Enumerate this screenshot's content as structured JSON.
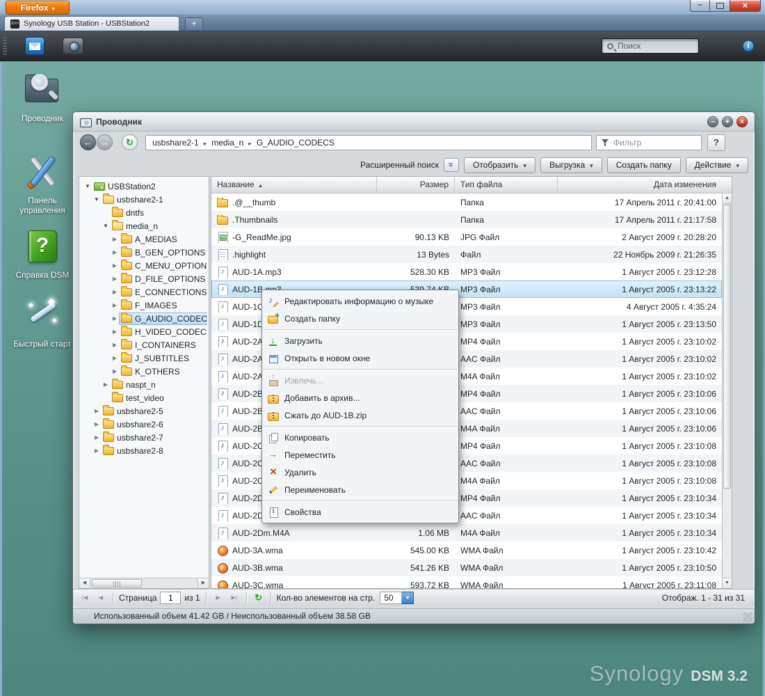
{
  "browser": {
    "firefox_label": "Firefox",
    "tab_title": "Synology USB Station - USBStation2",
    "new_tab_label": "+",
    "search_placeholder": "Поиск"
  },
  "desktop": {
    "icons": [
      {
        "label": "Проводник",
        "icon": "explorer-icon"
      },
      {
        "label": "Панель управления",
        "icon": "control-panel-icon"
      },
      {
        "label": "Справка DSM",
        "icon": "help-book-icon"
      },
      {
        "label": "Быстрый старт",
        "icon": "magic-wand-icon"
      }
    ],
    "watermark_brand": "Synology",
    "watermark_version": "DSM 3.2"
  },
  "explorer": {
    "title": "Проводник",
    "help_label": "?",
    "filter_placeholder": "Фильтр",
    "breadcrumb": [
      "usbshare2-1",
      "media_n",
      "G_AUDIO_CODECS"
    ],
    "toolbar": [
      {
        "label": "Отобразить",
        "dropdown": true
      },
      {
        "label": "Выгрузка",
        "dropdown": true
      },
      {
        "label": "Создать папку",
        "dropdown": false
      },
      {
        "label": "Действие",
        "dropdown": true
      }
    ],
    "advanced_search": "Расширенный поиск",
    "tree": [
      {
        "label": "USBStation2",
        "level": 0,
        "icon": "server",
        "arrow": "expanded"
      },
      {
        "label": "usbshare2-1",
        "level": 1,
        "icon": "folder-open",
        "arrow": "expanded"
      },
      {
        "label": "dntfs",
        "level": 2,
        "icon": "folder",
        "arrow": "none"
      },
      {
        "label": "media_n",
        "level": 2,
        "icon": "folder-open",
        "arrow": "expanded"
      },
      {
        "label": "A_MEDIAS",
        "level": 3,
        "icon": "folder",
        "arrow": "collapsed"
      },
      {
        "label": "B_GEN_OPTIONS",
        "level": 3,
        "icon": "folder",
        "arrow": "collapsed"
      },
      {
        "label": "C_MENU_OPTIONS",
        "level": 3,
        "icon": "folder",
        "arrow": "collapsed"
      },
      {
        "label": "D_FILE_OPTIONS",
        "level": 3,
        "icon": "folder",
        "arrow": "collapsed"
      },
      {
        "label": "E_CONNECTIONS",
        "level": 3,
        "icon": "folder",
        "arrow": "collapsed"
      },
      {
        "label": "F_IMAGES",
        "level": 3,
        "icon": "folder",
        "arrow": "collapsed"
      },
      {
        "label": "G_AUDIO_CODECS",
        "level": 3,
        "icon": "folder",
        "arrow": "collapsed",
        "selected": true
      },
      {
        "label": "H_VIDEO_CODECS",
        "level": 3,
        "icon": "folder",
        "arrow": "collapsed"
      },
      {
        "label": "I_CONTAINERS",
        "level": 3,
        "icon": "folder",
        "arrow": "collapsed"
      },
      {
        "label": "J_SUBTITLES",
        "level": 3,
        "icon": "folder",
        "arrow": "collapsed"
      },
      {
        "label": "K_OTHERS",
        "level": 3,
        "icon": "folder",
        "arrow": "collapsed"
      },
      {
        "label": "naspt_n",
        "level": 2,
        "icon": "folder",
        "arrow": "collapsed"
      },
      {
        "label": "test_video",
        "level": 2,
        "icon": "folder",
        "arrow": "none"
      },
      {
        "label": "usbshare2-5",
        "level": 1,
        "icon": "folder",
        "arrow": "collapsed"
      },
      {
        "label": "usbshare2-6",
        "level": 1,
        "icon": "folder",
        "arrow": "collapsed"
      },
      {
        "label": "usbshare2-7",
        "level": 1,
        "icon": "folder",
        "arrow": "collapsed"
      },
      {
        "label": "usbshare2-8",
        "level": 1,
        "icon": "folder",
        "arrow": "collapsed"
      }
    ],
    "columns": {
      "name": "Название",
      "size": "Размер",
      "type": "Тип файла",
      "date": "Дата изменения"
    },
    "files": [
      {
        "name": ".@__thumb",
        "size": "",
        "type": "Папка",
        "date": "17 Апрель 2011 г. 20:41:00",
        "icon": "folder"
      },
      {
        "name": ".Thumbnails",
        "size": "",
        "type": "Папка",
        "date": "17 Апрель 2011 г. 21:17:58",
        "icon": "folder"
      },
      {
        "name": "-G_ReadMe.jpg",
        "size": "90.13 KB",
        "type": "JPG Файл",
        "date": "2 Август 2009 г. 20:28:20",
        "icon": "image"
      },
      {
        "name": ".highlight",
        "size": "13 Bytes",
        "type": "Файл",
        "date": "22 Ноябрь 2009 г. 21:26:35",
        "icon": "file"
      },
      {
        "name": "AUD-1A.mp3",
        "size": "528.30 KB",
        "type": "MP3 Файл",
        "date": "1 Август 2005 г. 23:12:28",
        "icon": "mp3"
      },
      {
        "name": "AUD-1B.mp3",
        "size": "539.74 KB",
        "type": "MP3 Файл",
        "date": "1 Август 2005 г. 23:13:22",
        "icon": "mp3",
        "selected": true
      },
      {
        "name": "AUD-1C",
        "size": "",
        "type": "MP3 Файл",
        "date": "4 Август 2005 г. 4:35:24",
        "icon": "mp3"
      },
      {
        "name": "AUD-1D",
        "size": "",
        "type": "MP3 Файл",
        "date": "1 Август 2005 г. 23:13:50",
        "icon": "mp3"
      },
      {
        "name": "AUD-2A",
        "size": "",
        "type": "MP4 Файл",
        "date": "1 Август 2005 г. 23:10:02",
        "icon": "mp4"
      },
      {
        "name": "AUD-2A",
        "size": "",
        "type": "AAC Файл",
        "date": "1 Август 2005 г. 23:10:02",
        "icon": "aac"
      },
      {
        "name": "AUD-2A",
        "size": "",
        "type": "M4A Файл",
        "date": "1 Август 2005 г. 23:10:02",
        "icon": "m4a"
      },
      {
        "name": "AUD-2B",
        "size": "",
        "type": "MP4 Файл",
        "date": "1 Август 2005 г. 23:10:06",
        "icon": "mp4"
      },
      {
        "name": "AUD-2B",
        "size": "",
        "type": "AAC Файл",
        "date": "1 Август 2005 г. 23:10:06",
        "icon": "aac"
      },
      {
        "name": "AUD-2B",
        "size": "",
        "type": "M4A Файл",
        "date": "1 Август 2005 г. 23:10:06",
        "icon": "m4a"
      },
      {
        "name": "AUD-2C",
        "size": "",
        "type": "MP4 Файл",
        "date": "1 Август 2005 г. 23:10:08",
        "icon": "mp4"
      },
      {
        "name": "AUD-2C",
        "size": "",
        "type": "AAC Файл",
        "date": "1 Август 2005 г. 23:10:08",
        "icon": "aac"
      },
      {
        "name": "AUD-2C",
        "size": "",
        "type": "M4A Файл",
        "date": "1 Август 2005 г. 23:10:08",
        "icon": "m4a"
      },
      {
        "name": "AUD-2D",
        "size": "",
        "type": "MP4 Файл",
        "date": "1 Август 2005 г. 23:10:34",
        "icon": "mp4"
      },
      {
        "name": "AUD-2D",
        "size": "",
        "type": "AAC Файл",
        "date": "1 Август 2005 г. 23:10:34",
        "icon": "aac"
      },
      {
        "name": "AUD-2Dm.M4A",
        "size": "1.06 MB",
        "type": "M4A Файл",
        "date": "1 Август 2005 г. 23:10:34",
        "icon": "m4a"
      },
      {
        "name": "AUD-3A.wma",
        "size": "545.00 KB",
        "type": "WMA Файл",
        "date": "1 Август 2005 г. 23:10:42",
        "icon": "wma"
      },
      {
        "name": "AUD-3B.wma",
        "size": "541.26 KB",
        "type": "WMA Файл",
        "date": "1 Август 2005 г. 23:10:50",
        "icon": "wma"
      },
      {
        "name": "AUD-3C.wma",
        "size": "593.72 KB",
        "type": "WMA Файл",
        "date": "1 Август 2005 г. 23:11:08",
        "icon": "wma"
      }
    ],
    "context_menu": [
      {
        "label": "Редактировать информацию о музыке",
        "icon": "music-edit"
      },
      {
        "label": "Создать папку",
        "icon": "folder-new"
      },
      {
        "label": "Загрузить",
        "icon": "download",
        "sep": true
      },
      {
        "label": "Открыть в новом окне",
        "icon": "open-window"
      },
      {
        "label": "Извлечь...",
        "icon": "extract",
        "disabled": true,
        "sep": true
      },
      {
        "label": "Добавить в архив...",
        "icon": "archive-add"
      },
      {
        "label": "Сжать до AUD-1B.zip",
        "icon": "zip"
      },
      {
        "label": "Копировать",
        "icon": "copy",
        "sep": true
      },
      {
        "label": "Переместить",
        "icon": "move"
      },
      {
        "label": "Удалить",
        "icon": "delete"
      },
      {
        "label": "Переименовать",
        "icon": "rename"
      },
      {
        "label": "Свойства",
        "icon": "properties",
        "sep": true
      }
    ],
    "pagination": {
      "page_label": "Страница",
      "page_value": "1",
      "of_label": "из 1",
      "per_page_label": "Кол-во элементов на стр.",
      "per_page_value": "50",
      "range_label": "Отображ. 1 - 31 из 31"
    },
    "status": "Использованный объем 41.42 GB / Неиспользованный объем 38.58 GB"
  }
}
